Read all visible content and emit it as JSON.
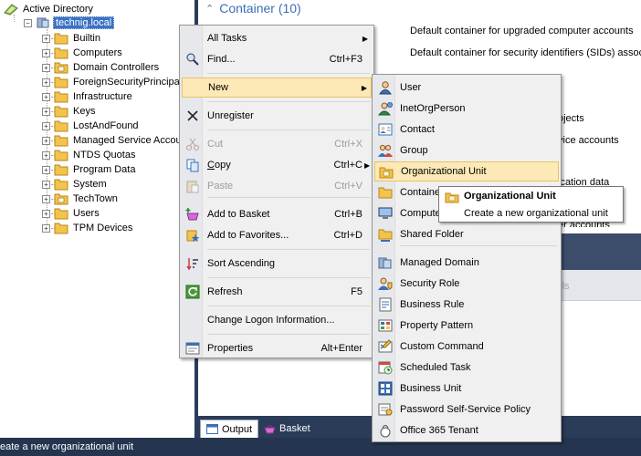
{
  "tree": {
    "root_label": "Active Directory",
    "domain_label": "technig.local",
    "items": [
      {
        "label": "Builtin",
        "icon": "folder-icon"
      },
      {
        "label": "Computers",
        "icon": "folder-icon"
      },
      {
        "label": "Domain Controllers",
        "icon": "ou-folder-icon"
      },
      {
        "label": "ForeignSecurityPrincipal",
        "icon": "folder-icon"
      },
      {
        "label": "Infrastructure",
        "icon": "folder-icon"
      },
      {
        "label": "Keys",
        "icon": "folder-icon"
      },
      {
        "label": "LostAndFound",
        "icon": "folder-icon"
      },
      {
        "label": "Managed Service Accou",
        "icon": "folder-icon"
      },
      {
        "label": "NTDS Quotas",
        "icon": "folder-icon"
      },
      {
        "label": "Program Data",
        "icon": "folder-icon"
      },
      {
        "label": "System",
        "icon": "folder-icon"
      },
      {
        "label": "TechTown",
        "icon": "ou-folder-icon"
      },
      {
        "label": "Users",
        "icon": "folder-icon"
      },
      {
        "label": "TPM Devices",
        "icon": "folder-icon"
      }
    ]
  },
  "right_pane": {
    "header": "Container",
    "header_count": "(10)",
    "descriptions": [
      "Default container for upgraded computer accounts",
      "Default container for security identifiers (SIDs) assoc",
      "ojects",
      "vice accounts",
      "ication data",
      "er accounts"
    ],
    "details_label": "ails"
  },
  "bottom_tabs": [
    {
      "label": "Output",
      "icon": "output-icon"
    },
    {
      "label": "Basket",
      "icon": "basket-icon"
    }
  ],
  "statusbar": {
    "text": "eate a new organizational unit"
  },
  "context_menu": {
    "items": [
      {
        "label": "All Tasks",
        "shortcut": "",
        "submenu": true
      },
      {
        "label": "Find...",
        "shortcut": "Ctrl+F3",
        "icon": "find-icon"
      },
      {
        "label": "New",
        "shortcut": "",
        "submenu": true
      },
      {
        "label": "Unregister",
        "shortcut": "",
        "icon": "close-icon"
      },
      {
        "label": "Cut",
        "shortcut": "Ctrl+X",
        "icon": "cut-icon",
        "disabled": true
      },
      {
        "label": "Copy",
        "shortcut": "Ctrl+C",
        "icon": "copy-icon"
      },
      {
        "label": "Paste",
        "shortcut": "Ctrl+V",
        "icon": "paste-icon",
        "disabled": true
      },
      {
        "label": "Add to Basket",
        "shortcut": "Ctrl+B",
        "icon": "basket-add-icon"
      },
      {
        "label": "Add to Favorites...",
        "shortcut": "Ctrl+D",
        "icon": "favorites-icon"
      },
      {
        "label": "Sort Ascending",
        "shortcut": "",
        "icon": "sort-icon"
      },
      {
        "label": "Refresh",
        "shortcut": "F5",
        "icon": "refresh-icon"
      },
      {
        "label": "Change Logon Information...",
        "shortcut": ""
      },
      {
        "label": "Properties",
        "shortcut": "Alt+Enter",
        "icon": "properties-icon"
      }
    ]
  },
  "new_submenu": {
    "items": [
      {
        "label": "User",
        "icon": "user-icon"
      },
      {
        "label": "InetOrgPerson",
        "icon": "inetorgperson-icon"
      },
      {
        "label": "Contact",
        "icon": "contact-icon"
      },
      {
        "label": "Group",
        "icon": "group-icon"
      },
      {
        "label": "Organizational Unit",
        "icon": "ou-icon"
      },
      {
        "label": "Container",
        "icon": "container-icon"
      },
      {
        "label": "Computer",
        "icon": "computer-icon"
      },
      {
        "label": "Shared Folder",
        "icon": "shared-folder-icon"
      },
      {
        "label": "Managed Domain",
        "icon": "managed-domain-icon"
      },
      {
        "label": "Security Role",
        "icon": "security-role-icon"
      },
      {
        "label": "Business Rule",
        "icon": "business-rule-icon"
      },
      {
        "label": "Property Pattern",
        "icon": "property-pattern-icon"
      },
      {
        "label": "Custom Command",
        "icon": "custom-command-icon"
      },
      {
        "label": "Scheduled Task",
        "icon": "scheduled-task-icon"
      },
      {
        "label": "Business Unit",
        "icon": "business-unit-icon"
      },
      {
        "label": "Password Self-Service Policy",
        "icon": "password-policy-icon"
      },
      {
        "label": "Office 365 Tenant",
        "icon": "office365-icon"
      }
    ]
  },
  "tooltip": {
    "title": "Organizational Unit",
    "description": "Create a new organizational unit"
  },
  "colors": {
    "accent": "#3b6fb6",
    "dark_chrome": "#2b3c59",
    "statusbar": "#253550",
    "menu_highlight": "#fde9b6"
  }
}
